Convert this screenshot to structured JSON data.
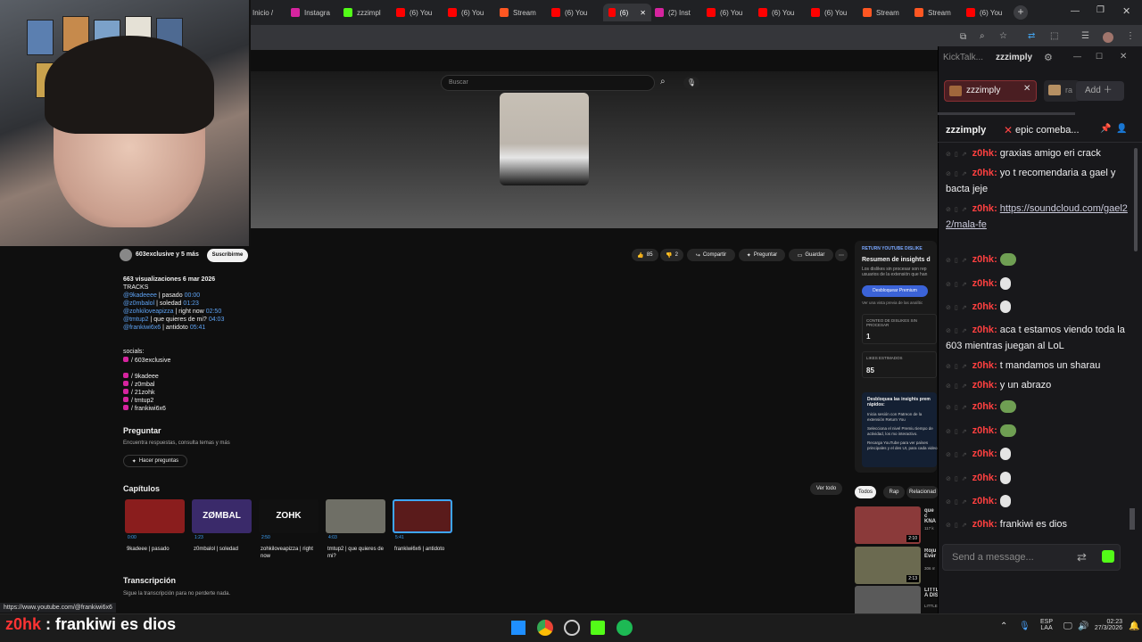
{
  "tabs": [
    {
      "label": "Inicio /",
      "color": "#555"
    },
    {
      "label": "Instagra",
      "color": "#d6249f"
    },
    {
      "label": "zzzimpl",
      "color": "#53fc18"
    },
    {
      "label": "(6) You",
      "color": "#ff0000"
    },
    {
      "label": "(6) You",
      "color": "#ff0000"
    },
    {
      "label": "Stream",
      "color": "#ff5722"
    },
    {
      "label": "(6) You",
      "color": "#ff0000"
    },
    {
      "label": "(6)",
      "color": "#ff0000"
    },
    {
      "label": "(2) Inst",
      "color": "#d6249f"
    },
    {
      "label": "(6) You",
      "color": "#ff0000"
    },
    {
      "label": "(6) You",
      "color": "#ff0000"
    },
    {
      "label": "(6) You",
      "color": "#ff0000"
    },
    {
      "label": "Stream",
      "color": "#ff5722"
    },
    {
      "label": "Stream",
      "color": "#ff5722"
    },
    {
      "label": "(6) You",
      "color": "#ff0000"
    }
  ],
  "youtube": {
    "search_placeholder": "Buscar",
    "channel": "603exclusive y 5 más",
    "subscribe": "Suscribirme",
    "likes": "85",
    "dislikes": "2",
    "share": "Compartir",
    "ask": "Preguntar",
    "save": "Guardar",
    "desc_meta": "663 visualizaciones 6 mar 2026",
    "desc_tracks_title": "TRACKS",
    "tracks": [
      {
        "user": "@9kadeeee",
        "title": "| pasado",
        "time": "00:00"
      },
      {
        "user": "@z0mbalol",
        "title": "| soledad",
        "time": "01:23"
      },
      {
        "user": "@zohkiloveapizza",
        "title": "| right now",
        "time": "02:50"
      },
      {
        "user": "@tmtup2",
        "title": "| que quieres de mi?",
        "time": "04:03"
      },
      {
        "user": "@frankiwi6x6",
        "title": "| antidoto",
        "time": "05:41"
      }
    ],
    "socials_title": "socials:",
    "socials": [
      "/ 603exclusive",
      "/ 9kadeee",
      "/ z0mbal",
      "/ 21zohk",
      "/ tmtup2",
      "/ frankiwi6x6"
    ],
    "ask_section_title": "Preguntar",
    "ask_section_sub": "Encuentra respuestas, consulta temas y más",
    "ask_button": "Hacer preguntas",
    "chapters_title": "Capítulos",
    "see_all": "Ver todo",
    "chapters": [
      {
        "time": "0:00",
        "title": "9kadeee | pasado",
        "color": "#8a1d1d"
      },
      {
        "time": "1:23",
        "title": "z0mbalol | soledad",
        "color": "#3a2a6a"
      },
      {
        "time": "2:50",
        "title": "zohkiloveapizza | right now",
        "color": "#111111"
      },
      {
        "time": "4:03",
        "title": "tmtup2 | que quieres de mi?",
        "color": "#6f6f66"
      },
      {
        "time": "5:41",
        "title": "frankiwi6x6 | antidoto",
        "color": "#5a1b1b"
      }
    ],
    "chapter_thumb_texts": [
      "",
      "ZØMBAL",
      "ZOHK",
      "",
      ""
    ],
    "transcript_title": "Transcripción",
    "transcript_sub": "Sigue la transcripción para no perderte nada.",
    "status_url": "https://www.youtube.com/@frankiwi6x6"
  },
  "sidebar": {
    "ryd_badge": "RETURN YOUTUBE DISLIKE",
    "ryd_title": "Resumen de insights d",
    "ryd_desc": "Los dislikes sin procesar son rep usuarios de la extensión que han",
    "ryd_button": "Desbloquear Premium",
    "ryd_preview": "Ver una vista previa de las analític",
    "raw_label": "CONTEO DE DISLIKES SIN PROCESAR",
    "raw_value": "1",
    "est_label": "LIKES ESTIMADOS",
    "est_value": "85",
    "unlock_title": "Desbloquea las insights prem rápidos:",
    "unlock_steps": [
      "Inicia sesión con Patreon de la extensión Return You",
      "Selecciona el nivel Premiu tiempo de actividad, los mo interactivo.",
      "Recarga YouTube para ver países principales y el des UI, para cada video."
    ],
    "chips": [
      "Todos",
      "Rap",
      "Relacionad"
    ],
    "recs": [
      {
        "title": "que c KNA",
        "meta": "117 k",
        "duration": "2:10",
        "color": "#8b3a3a"
      },
      {
        "title": "Roju Ever",
        "meta": "306 m",
        "duration": "2:13",
        "color": "#6b6a50"
      },
      {
        "title": "LITTLE BOOGIE & MILO J - VOY A DISPARARME (VIDEOCLIP ...",
        "meta": "LITTLE BOOGIE y MILO J",
        "duration": "",
        "color": "#5a5a5a"
      }
    ]
  },
  "kicktalk": {
    "app": "KickTalk...",
    "window_title": "zzzimply",
    "tab_channel": "zzzimply",
    "tab_second": "ra",
    "add": "Add",
    "pinned_user": "zzzimply",
    "pinned_msg": "epic comeba...",
    "send_placeholder": "Send a message...",
    "messages": [
      {
        "user": "z0hk",
        "text": "graxias amigo eri crack",
        "emote": ""
      },
      {
        "user": "z0hk",
        "text": "yo t recomendaria a gael y bacta jeje",
        "emote": ""
      },
      {
        "user": "z0hk",
        "text": "https://soundcloud.com/gael22/mala-fe",
        "emote": "",
        "link": true
      },
      {
        "user": "z0hk",
        "text": "",
        "emote": "green"
      },
      {
        "user": "z0hk",
        "text": "",
        "emote": "white"
      },
      {
        "user": "z0hk",
        "text": "",
        "emote": "white"
      },
      {
        "user": "z0hk",
        "text": "aca t estamos viendo toda la 603 mientras juegan al LoL",
        "emote": ""
      },
      {
        "user": "z0hk",
        "text": "t mandamos un sharau",
        "emote": ""
      },
      {
        "user": "z0hk",
        "text": "y un abrazo",
        "emote": ""
      },
      {
        "user": "z0hk",
        "text": "",
        "emote": "green"
      },
      {
        "user": "z0hk",
        "text": "",
        "emote": "green"
      },
      {
        "user": "z0hk",
        "text": "",
        "emote": "white"
      },
      {
        "user": "z0hk",
        "text": "",
        "emote": "white"
      },
      {
        "user": "z0hk",
        "text": "",
        "emote": "white"
      },
      {
        "user": "z0hk",
        "text": "frankiwi es dios",
        "emote": ""
      }
    ]
  },
  "overlay": {
    "user": "z0hk",
    "separator": " : ",
    "text": "frankiwi es dios"
  },
  "taskbar": {
    "lang_top": "ESP",
    "lang_bottom": "LAA",
    "time": "02:23",
    "date": "27/3/2026"
  }
}
